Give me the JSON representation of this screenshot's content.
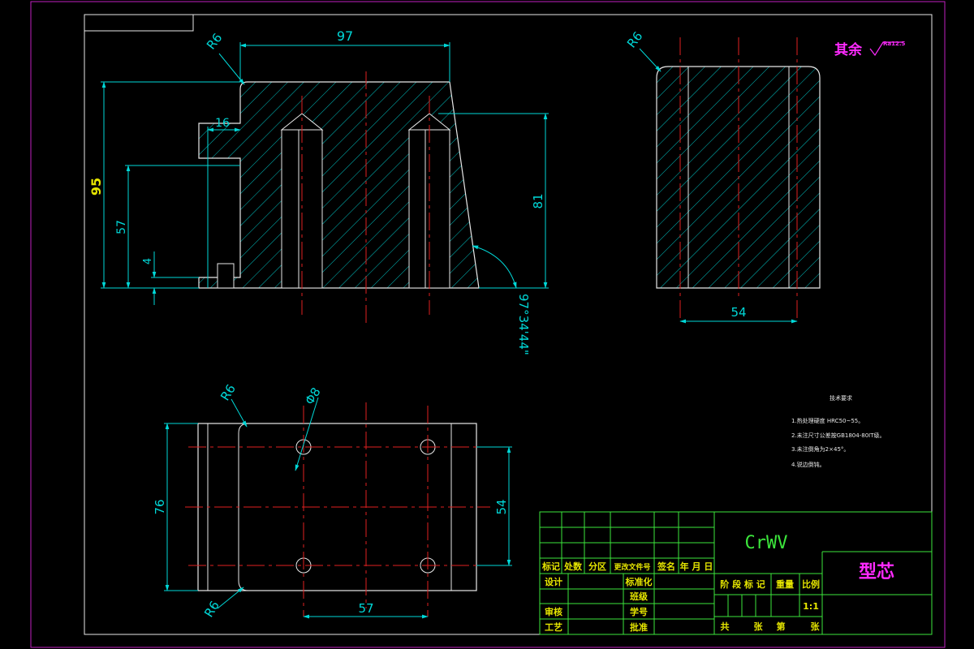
{
  "drawing": {
    "surface_note": "其余",
    "roughness_value": "Ra12.5",
    "dimensions": {
      "width_top": "97",
      "height_total": "95",
      "step_width": "16",
      "height_57": "57",
      "height_4": "4",
      "height_81": "81",
      "angle": "97°34'44\"",
      "radius_front": "R6",
      "side_width": "54",
      "radius_side": "R6",
      "plan_radius_top": "R6",
      "plan_hole_dia": "Φ8",
      "plan_width_76": "76",
      "plan_spacing_54": "54",
      "plan_spacing_57": "57",
      "plan_radius_bottom": "R6"
    },
    "tech_notes": {
      "title": "技术要求",
      "items": [
        "1.热处理硬度 HRC50~55。",
        "2.未注尺寸公差按GB1804-80IT级。",
        "3.未注倒角为2×45°。",
        "4.锐边倒钝。"
      ]
    }
  },
  "title_block": {
    "material": "CrWV",
    "part_name": "型芯",
    "scale_value": "1:1",
    "rev_labels": [
      "标记",
      "处数",
      "分区",
      "更改文件号",
      "签名",
      "年 月 日"
    ],
    "left_labels": [
      "设计",
      "审核",
      "工艺"
    ],
    "mid_labels": [
      "标准化",
      "班级",
      "学号",
      "批准"
    ],
    "stage_labels": [
      "阶 段 标 记",
      "重量",
      "比例"
    ],
    "sheet_labels": [
      "共",
      "张",
      "第",
      "张"
    ]
  }
}
